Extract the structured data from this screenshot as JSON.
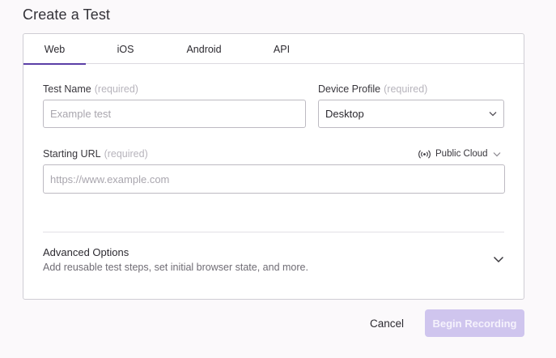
{
  "page": {
    "title": "Create a Test"
  },
  "tabs": [
    {
      "label": "Web",
      "active": true
    },
    {
      "label": "iOS",
      "active": false
    },
    {
      "label": "Android",
      "active": false
    },
    {
      "label": "API",
      "active": false
    }
  ],
  "form": {
    "test_name": {
      "label": "Test Name",
      "required_note": "(required)",
      "placeholder": "Example test",
      "value": ""
    },
    "device_profile": {
      "label": "Device Profile",
      "required_note": "(required)",
      "selected": "Desktop"
    },
    "starting_url": {
      "label": "Starting URL",
      "required_note": "(required)",
      "placeholder": "https://www.example.com",
      "value": ""
    },
    "cloud": {
      "selected": "Public Cloud",
      "icon": "broadcast-icon"
    }
  },
  "advanced": {
    "title": "Advanced Options",
    "description": "Add reusable test steps, set initial browser state, and more."
  },
  "actions": {
    "cancel_label": "Cancel",
    "begin_label": "Begin Recording"
  },
  "colors": {
    "accent": "#5b3fa6",
    "begin_disabled_bg": "#cfc5ee",
    "border": "#bdbac2"
  }
}
